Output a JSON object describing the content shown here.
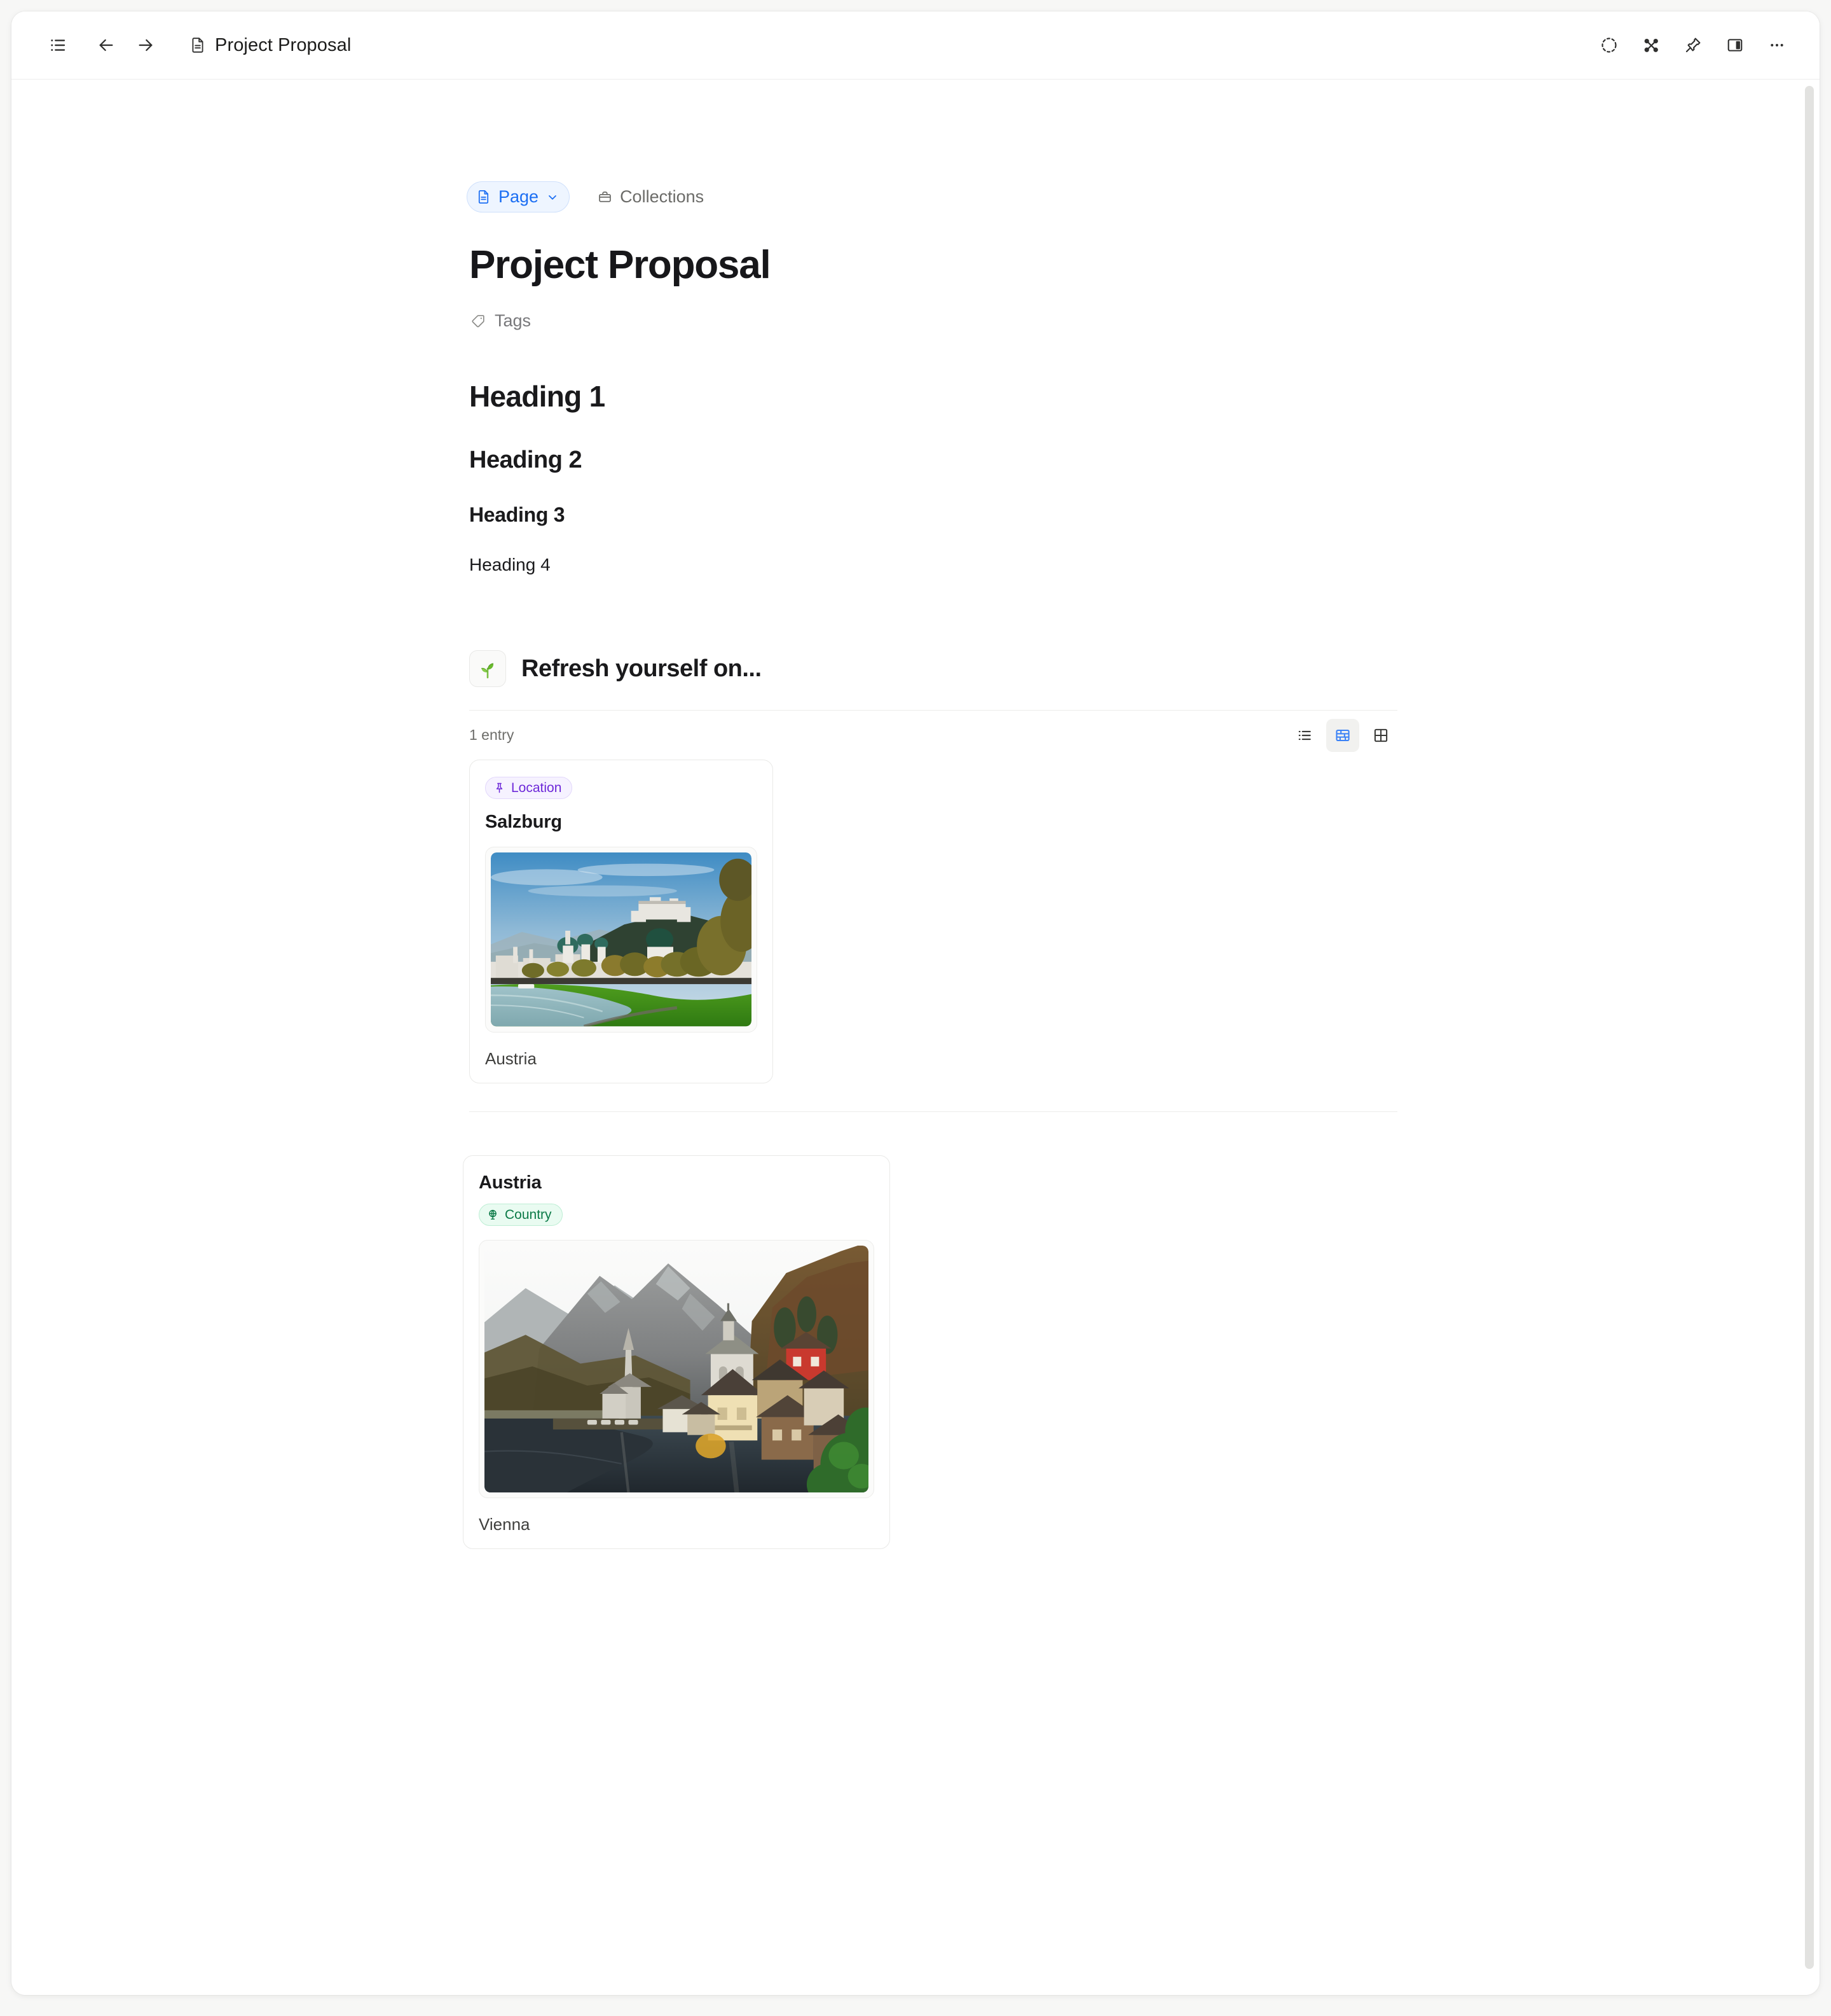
{
  "titlebar": {
    "sidebar_toggle_icon": "list-sidebar-icon",
    "back_icon": "arrow-left-icon",
    "forward_icon": "arrow-right-icon",
    "doc_icon": "document-icon",
    "doc_title": "Project Proposal",
    "actions": [
      {
        "name": "frame-capture-icon",
        "label": ""
      },
      {
        "name": "graph-view-icon",
        "label": ""
      },
      {
        "name": "pin-icon",
        "label": ""
      },
      {
        "name": "split-panel-icon",
        "label": ""
      },
      {
        "name": "more-options-icon",
        "label": ""
      }
    ]
  },
  "tabs": [
    {
      "label": "Page",
      "icon": "document-icon",
      "active": true,
      "has_chevron": true
    },
    {
      "label": "Collections",
      "icon": "briefcase-icon",
      "active": false,
      "has_chevron": false
    }
  ],
  "page": {
    "title": "Project Proposal",
    "tags_label": "Tags",
    "tags_icon": "tag-icon"
  },
  "headings": [
    {
      "level": 1,
      "text": "Heading 1"
    },
    {
      "level": 2,
      "text": "Heading 2"
    },
    {
      "level": 3,
      "text": "Heading 3"
    },
    {
      "level": 4,
      "text": "Heading 4"
    }
  ],
  "collection": {
    "emoji": "🌱",
    "emoji_name": "seedling-emoji",
    "title": "Refresh yourself on...",
    "entry_count_label": "1 entry",
    "view_toggles": [
      {
        "name": "list-view-icon",
        "active": false
      },
      {
        "name": "gallery-view-icon",
        "active": true
      },
      {
        "name": "grid-view-icon",
        "active": false
      }
    ]
  },
  "cards": [
    {
      "badge_label": "Location",
      "badge_icon": "pin-icon",
      "badge_type": "location",
      "name": "Salzburg",
      "subtitle": "Austria",
      "image_alt": "salzburg-riverfront-photo"
    },
    {
      "badge_label": "Country",
      "badge_icon": "globe-icon",
      "badge_type": "country",
      "name": "Austria",
      "subtitle": "Vienna",
      "image_alt": "hallstatt-lakeside-village-photo"
    }
  ],
  "colors": {
    "accent_blue": "#1b6ef3",
    "badge_location_text": "#6d28d9",
    "badge_location_bg": "#f6f2ff",
    "badge_country_text": "#0b7a47",
    "badge_country_bg": "#e9fbf1",
    "window_bg": "#ffffff",
    "desktop_bg": "#f7f7f6"
  }
}
